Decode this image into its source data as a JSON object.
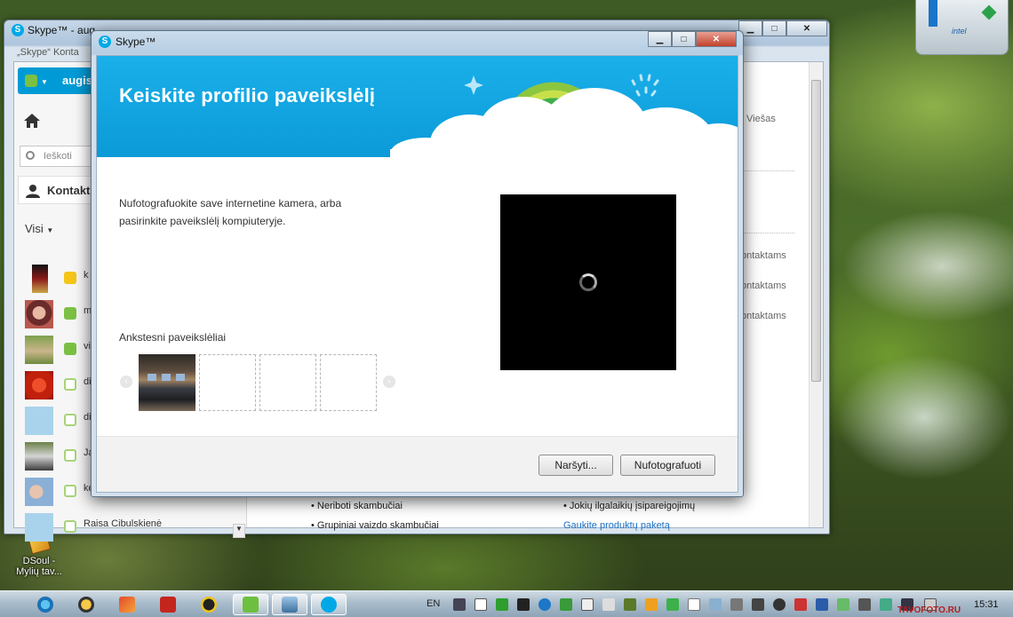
{
  "main_window": {
    "title": "Skype™ - aug",
    "menu": "„Skype“    Konta",
    "account_name": "augis",
    "home_label": "",
    "search_placeholder": "Ieškoti",
    "contacts_header": "Kontakt",
    "filter_label": "Visi",
    "contacts": [
      {
        "name": "k",
        "status": "away",
        "status_color": "#f5c518"
      },
      {
        "name": "m",
        "status": "online",
        "status_color": "#7bc043"
      },
      {
        "name": "vi",
        "status": "online",
        "status_color": "#7bc043"
      },
      {
        "name": "di",
        "status": "offline",
        "status_color": "#a8d37a"
      },
      {
        "name": "di",
        "status": "offline",
        "status_color": "#a8d37a"
      },
      {
        "name": "Ja",
        "status": "offline",
        "status_color": "#a8d37a"
      },
      {
        "name": "ke",
        "status": "offline",
        "status_color": "#a8d37a"
      },
      {
        "name": "Raisa Cibulskienė",
        "status": "offline",
        "status_color": "#a8d37a"
      }
    ],
    "right_texts": {
      "privacy": "Viešas",
      "contacts_1": "ontaktams",
      "contacts_2": "ontaktams",
      "contacts_3": "ontaktams",
      "bullet_1": "• Neriboti skambučiai",
      "bullet_2": "• Grupiniai vaizdo skambučiai",
      "bullet_3": "• Jokių ilgalaikių įsipareigojimų",
      "link": "Gaukite produktų paketą"
    }
  },
  "dialog": {
    "title": "Skype™",
    "heading": "Keiskite profilio paveikslėlį",
    "description": "Nufotografuokite save internetine kamera, arba pasirinkite paveikslėlį kompiuteryje.",
    "previous_label": "Ankstesni paveikslėliai",
    "browse_button": "Naršyti...",
    "photo_button": "Nufotografuoti",
    "accent_color": "#0a9ad8"
  },
  "desktop": {
    "icon_label": "DSoul - Mylių tav..."
  },
  "taskbar": {
    "language": "EN",
    "clock": "15:31",
    "watermark": "TAVOFOTO.RU"
  }
}
